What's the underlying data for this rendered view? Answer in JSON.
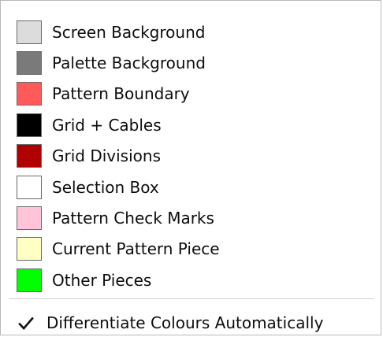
{
  "menu": {
    "items": [
      {
        "label": "Screen Background",
        "color": "#dcdcdc"
      },
      {
        "label": "Palette Background",
        "color": "#7a7a7a"
      },
      {
        "label": "Pattern Boundary",
        "color": "#ff5a5a"
      },
      {
        "label": "Grid + Cables",
        "color": "#000000"
      },
      {
        "label": "Grid Divisions",
        "color": "#b00000"
      },
      {
        "label": "Selection Box",
        "color": "#ffffff"
      },
      {
        "label": "Pattern Check Marks",
        "color": "#ffc4d8"
      },
      {
        "label": "Current Pattern Piece",
        "color": "#ffffc4"
      },
      {
        "label": "Other Pieces",
        "color": "#00ff00"
      }
    ],
    "differentiate": {
      "label": "Differentiate Colours Automatically",
      "checked": true,
      "icon": "checkmark-icon"
    }
  }
}
